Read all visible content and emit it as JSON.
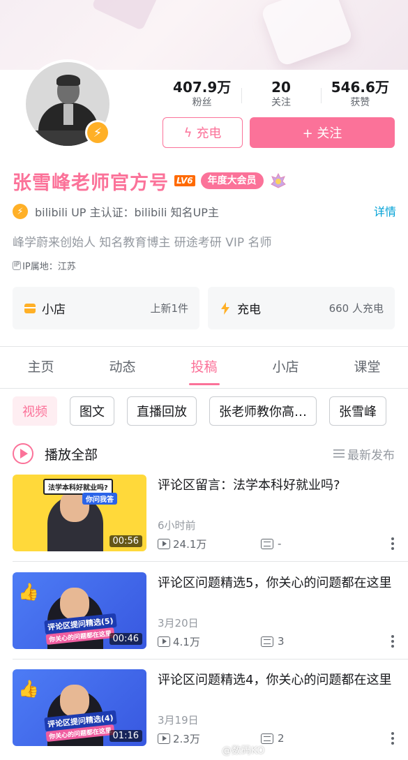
{
  "profile": {
    "name": "张雪峰老师官方号",
    "level": "LV6",
    "vip_badge": "年度大会员",
    "cert_text": "bilibili UP 主认证：bilibili 知名UP主",
    "cert_detail_link": "详情",
    "sign": "峰学蔚来创始人 知名教育博主 研途考研 VIP 名师",
    "ip_tag": "IP",
    "ip_location": "IP属地：江苏"
  },
  "stats": [
    {
      "value": "407.9万",
      "label": "粉丝"
    },
    {
      "value": "20",
      "label": "关注"
    },
    {
      "value": "546.6万",
      "label": "获赞"
    }
  ],
  "actions": {
    "charge_label": "充电",
    "follow_label": "+ 关注"
  },
  "cards": {
    "shop_title": "小店",
    "shop_info": "上新1件",
    "charge_title": "充电",
    "charge_info": "660 人充电"
  },
  "tabs": [
    "主页",
    "动态",
    "投稿",
    "小店",
    "课堂"
  ],
  "active_tab": "投稿",
  "chips": [
    "视频",
    "图文",
    "直播回放",
    "张老师教你高…",
    "张雪峰"
  ],
  "playlist": {
    "play_all_label": "播放全部",
    "sort_label": "最新发布"
  },
  "videos": [
    {
      "title": "评论区留言：法学本科好就业吗?",
      "date": "6小时前",
      "plays": "24.1万",
      "comments": "-",
      "duration": "00:56",
      "thumb_banner": "法学本科好就业吗?",
      "thumb_sub": "你问我答"
    },
    {
      "title": "评论区问题精选5，你关心的问题都在这里",
      "date": "3月20日",
      "plays": "4.1万",
      "comments": "3",
      "duration": "00:46",
      "thumb_title": "评论区提问精选(5)",
      "thumb_sub": "你关心的问题都在这里"
    },
    {
      "title": "评论区问题精选4，你关心的问题都在这里",
      "date": "3月19日",
      "plays": "2.3万",
      "comments": "2",
      "duration": "01:16",
      "thumb_title": "评论区提问精选(4)",
      "thumb_sub": "你关心的问题都在这里"
    }
  ],
  "watermark": "@数码KO",
  "colors": {
    "accent": "#fb7299",
    "link": "#00a1d6",
    "gold": "#ffb027",
    "text_primary": "#18191c",
    "text_secondary": "#61666d",
    "text_muted": "#9499a0"
  }
}
